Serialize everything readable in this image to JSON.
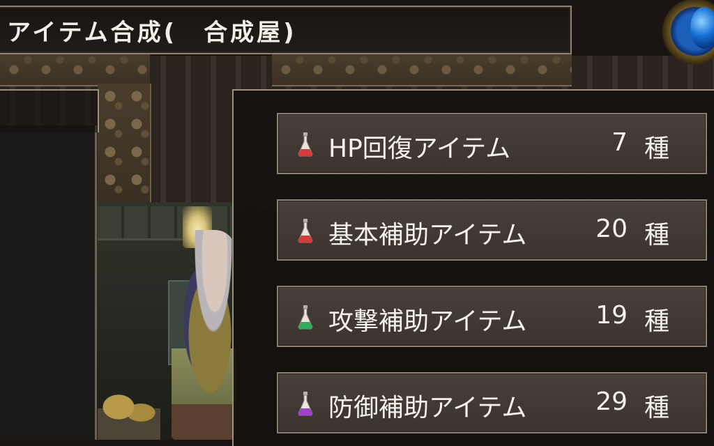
{
  "header": {
    "title": "アイテム合成(　合成屋)"
  },
  "items": [
    {
      "label": "HP回復アイテム",
      "count": "7",
      "unit": "種",
      "potion_color": "#d83a3a",
      "icon": "red-potion-icon"
    },
    {
      "label": "基本補助アイテム",
      "count": "20",
      "unit": "種",
      "potion_color": "#d83a3a",
      "icon": "red-potion-icon"
    },
    {
      "label": "攻撃補助アイテム",
      "count": "19",
      "unit": "種",
      "potion_color": "#2fae5a",
      "icon": "green-potion-icon"
    },
    {
      "label": "防御補助アイテム",
      "count": "29",
      "unit": "種",
      "potion_color": "#a23fcf",
      "icon": "purple-potion-icon"
    }
  ],
  "colors": {
    "panel_border": "#9c917f",
    "text": "#f4f1ec",
    "orb": "#1670d6"
  }
}
